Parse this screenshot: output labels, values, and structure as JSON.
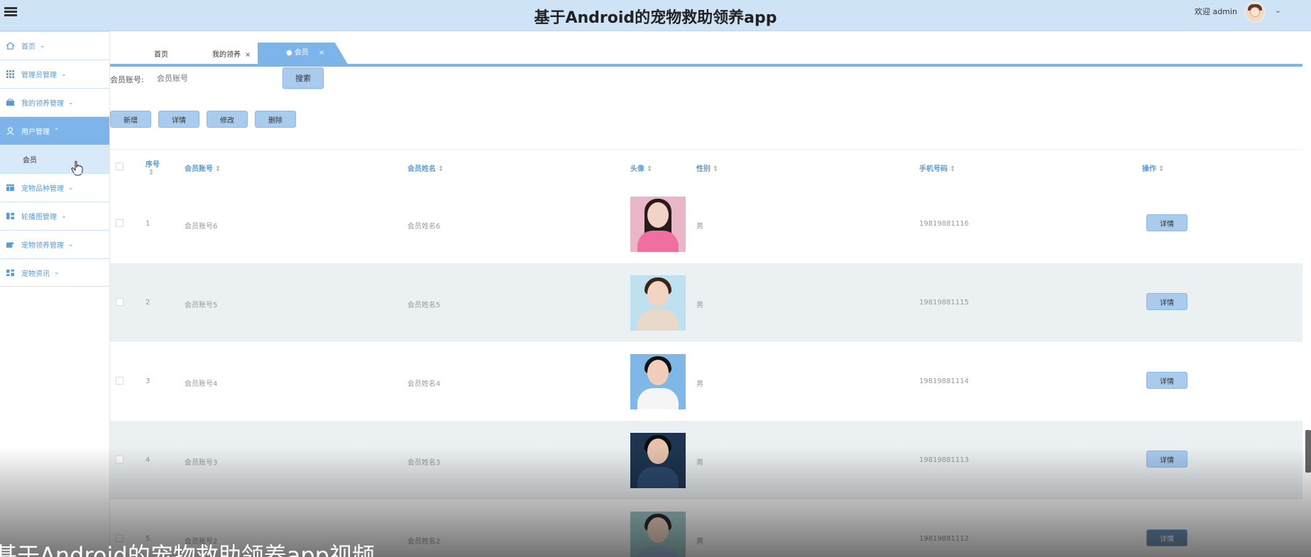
{
  "header": {
    "title": "基于Android的宠物救助领养app",
    "welcome": "欢迎 admin"
  },
  "sidebar": {
    "items": [
      {
        "label": "首页",
        "icon": "home-icon"
      },
      {
        "label": "管理员管理",
        "icon": "grid-icon"
      },
      {
        "label": "我的领养管理",
        "icon": "box-icon"
      },
      {
        "label": "用户管理",
        "icon": "user-icon"
      },
      {
        "label": "会员",
        "icon": ""
      },
      {
        "label": "宠物品种管理",
        "icon": "table-icon"
      },
      {
        "label": "轮播图管理",
        "icon": "layout-icon"
      },
      {
        "label": "宠物领养管理",
        "icon": "edit-icon"
      },
      {
        "label": "宠物资讯",
        "icon": "dashboard-icon"
      }
    ]
  },
  "tabs": [
    {
      "label": "首页"
    },
    {
      "label": "我的领养",
      "close": "×"
    },
    {
      "label": "● 会员",
      "close": "×"
    }
  ],
  "search": {
    "label": "会员账号:",
    "placeholder": "会员账号",
    "button": "搜索"
  },
  "actions": {
    "add": "新增",
    "detail": "详情",
    "edit": "修改",
    "delete": "删除"
  },
  "table": {
    "columns": [
      "序号",
      "会员账号",
      "会员姓名",
      "头像",
      "性别",
      "手机号码",
      "操作"
    ],
    "rows": [
      {
        "index": "1",
        "account": "会员账号6",
        "name": "会员姓名6",
        "gender": "男",
        "phone": "19819881116",
        "action": "详情"
      },
      {
        "index": "2",
        "account": "会员账号5",
        "name": "会员姓名5",
        "gender": "男",
        "phone": "19819881115",
        "action": "详情"
      },
      {
        "index": "3",
        "account": "会员账号4",
        "name": "会员姓名4",
        "gender": "男",
        "phone": "19819881114",
        "action": "详情"
      },
      {
        "index": "4",
        "account": "会员账号3",
        "name": "会员姓名3",
        "gender": "男",
        "phone": "19819881113",
        "action": "详情"
      },
      {
        "index": "5",
        "account": "会员账号2",
        "name": "会员姓名2",
        "gender": "男",
        "phone": "19819881112",
        "action": "详情"
      }
    ]
  },
  "caption": "基于Android的宠物救助领养app视频",
  "colors": {
    "accent": "#7db5ea",
    "header_bg": "#cfe3f7",
    "button_bg": "#a9cbee"
  }
}
